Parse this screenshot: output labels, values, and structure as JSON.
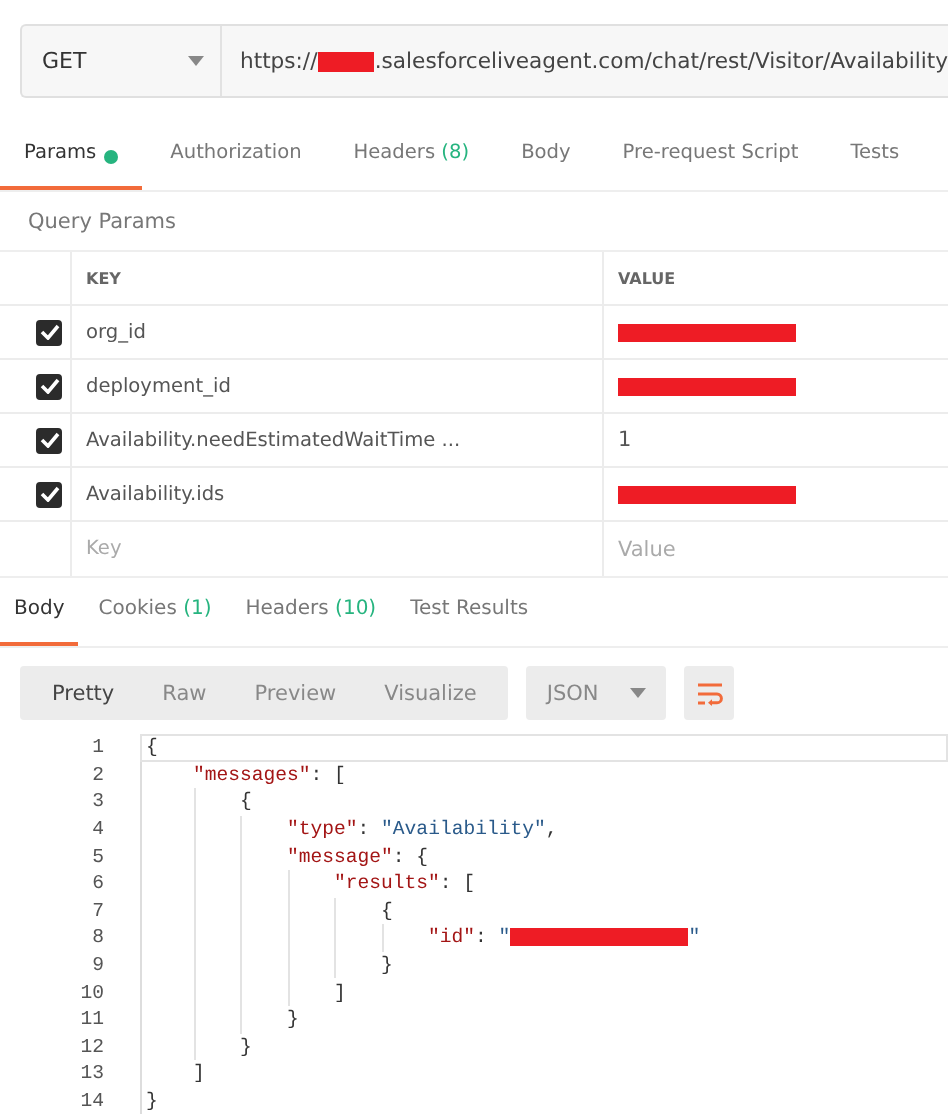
{
  "request": {
    "method": "GET",
    "url_prefix": "https://",
    "url_redacted": true,
    "url_suffix": ".salesforceliveagent.com/chat/rest/Visitor/Availability"
  },
  "request_tabs": [
    {
      "label": "Params",
      "dot": true,
      "selected": true
    },
    {
      "label": "Authorization",
      "dot": false,
      "selected": false
    },
    {
      "label": "Headers",
      "count": "(8)",
      "dot": false,
      "selected": false
    },
    {
      "label": "Body",
      "dot": false,
      "selected": false
    },
    {
      "label": "Pre-request Script",
      "dot": false,
      "selected": false
    },
    {
      "label": "Tests",
      "dot": false,
      "selected": false
    }
  ],
  "section_title": "Query Params",
  "params": {
    "columns": [
      "KEY",
      "VALUE"
    ],
    "rows": [
      {
        "checked": true,
        "key": "org_id",
        "redacted": true
      },
      {
        "checked": true,
        "key": "deployment_id",
        "redacted": true
      },
      {
        "checked": true,
        "key": "Availability.needEstimatedWaitTime ...",
        "value": "1",
        "redacted": false
      },
      {
        "checked": true,
        "key": "Availability.ids",
        "redacted": true
      }
    ],
    "placeholder_row": {
      "key": "Key",
      "value": "Value"
    }
  },
  "response_tabs": [
    {
      "label": "Body",
      "selected": true
    },
    {
      "label": "Cookies",
      "count": "(1)",
      "selected": false
    },
    {
      "label": "Headers",
      "count": "(10)",
      "selected": false
    },
    {
      "label": "Test Results",
      "selected": false
    }
  ],
  "view_modes": [
    {
      "label": "Pretty",
      "selected": true
    },
    {
      "label": "Raw",
      "selected": false
    },
    {
      "label": "Preview",
      "selected": false
    },
    {
      "label": "Visualize",
      "selected": false
    }
  ],
  "format": "JSON",
  "code_lines": [
    {
      "number": "1",
      "parts": [
        {
          "kind": "punct",
          "text": "{"
        }
      ],
      "children": [
        {
          "number": "2",
          "parts": [
            {
              "kind": "key",
              "text": "\"messages\""
            },
            {
              "kind": "punct",
              "text": ": ["
            }
          ],
          "children": [
            {
              "number": "3",
              "parts": [
                {
                  "kind": "punct",
                  "text": "{"
                }
              ],
              "children": [
                {
                  "number": "4",
                  "parts": [
                    {
                      "kind": "key",
                      "text": "\"type\""
                    },
                    {
                      "kind": "punct",
                      "text": ": "
                    },
                    {
                      "kind": "string",
                      "text": "\"Availability\""
                    },
                    {
                      "kind": "punct",
                      "text": ","
                    }
                  ]
                },
                {
                  "number": "5",
                  "parts": [
                    {
                      "kind": "key",
                      "text": "\"message\""
                    },
                    {
                      "kind": "punct",
                      "text": ": {"
                    }
                  ],
                  "children": [
                    {
                      "number": "6",
                      "parts": [
                        {
                          "kind": "key",
                          "text": "\"results\""
                        },
                        {
                          "kind": "punct",
                          "text": ": ["
                        }
                      ],
                      "children": [
                        {
                          "number": "7",
                          "parts": [
                            {
                              "kind": "punct",
                              "text": "{"
                            }
                          ],
                          "children": [
                            {
                              "number": "8",
                              "parts": [
                                {
                                  "kind": "key",
                                  "text": "\"id\""
                                },
                                {
                                  "kind": "punct",
                                  "text": ": "
                                },
                                {
                                  "kind": "string",
                                  "text": "\""
                                },
                                {
                                  "kind": "redaction"
                                },
                                {
                                  "kind": "string",
                                  "text": "\""
                                }
                              ]
                            }
                          ]
                        },
                        {
                          "number": "9",
                          "parts": [
                            {
                              "kind": "punct",
                              "text": "}"
                            }
                          ]
                        }
                      ]
                    },
                    {
                      "number": "10",
                      "parts": [
                        {
                          "kind": "punct",
                          "text": "]"
                        }
                      ]
                    }
                  ]
                },
                {
                  "number": "11",
                  "parts": [
                    {
                      "kind": "punct",
                      "text": "}"
                    }
                  ]
                }
              ]
            },
            {
              "number": "12",
              "parts": [
                {
                  "kind": "punct",
                  "text": "}"
                }
              ]
            }
          ]
        },
        {
          "number": "13",
          "parts": [
            {
              "kind": "punct",
              "text": "]"
            }
          ]
        }
      ]
    },
    {
      "number": "14",
      "parts": [
        {
          "kind": "punct",
          "text": "}"
        }
      ]
    }
  ]
}
